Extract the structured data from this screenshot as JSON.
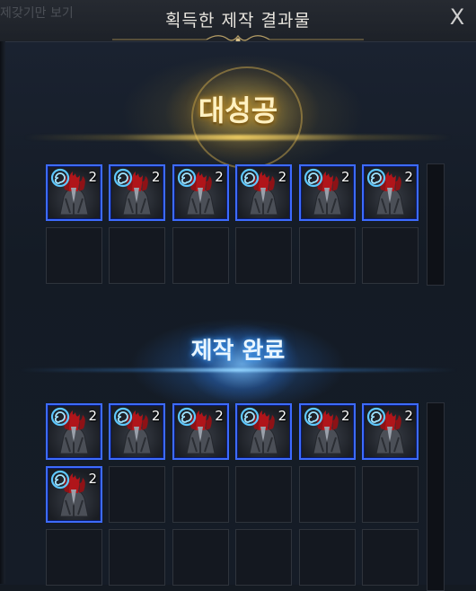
{
  "window": {
    "background_text": "제갖기만 보기",
    "title": "획득한 제작 결과물",
    "close_label": "X"
  },
  "great_success": {
    "label": "대성공",
    "items": [
      {
        "icon": "spiral-rune-armor-icon",
        "quantity": "2"
      },
      {
        "icon": "spiral-rune-armor-icon",
        "quantity": "2"
      },
      {
        "icon": "spiral-rune-armor-icon",
        "quantity": "2"
      },
      {
        "icon": "spiral-rune-armor-icon",
        "quantity": "2"
      },
      {
        "icon": "spiral-rune-armor-icon",
        "quantity": "2"
      },
      {
        "icon": "spiral-rune-armor-icon",
        "quantity": "2"
      }
    ],
    "total_slots": 12
  },
  "craft_complete": {
    "label": "제작 완료",
    "items": [
      {
        "icon": "spiral-rune-armor-icon",
        "quantity": "2"
      },
      {
        "icon": "spiral-rune-armor-icon",
        "quantity": "2"
      },
      {
        "icon": "spiral-rune-armor-icon",
        "quantity": "2"
      },
      {
        "icon": "spiral-rune-armor-icon",
        "quantity": "2"
      },
      {
        "icon": "spiral-rune-armor-icon",
        "quantity": "2"
      },
      {
        "icon": "spiral-rune-armor-icon",
        "quantity": "2"
      },
      {
        "icon": "spiral-rune-armor-icon",
        "quantity": "2"
      }
    ],
    "total_slots": 18
  },
  "colors": {
    "item_border": "#3d6bff",
    "great_success_glow": "#c9962c",
    "craft_complete_glow": "#4aa8ff"
  }
}
